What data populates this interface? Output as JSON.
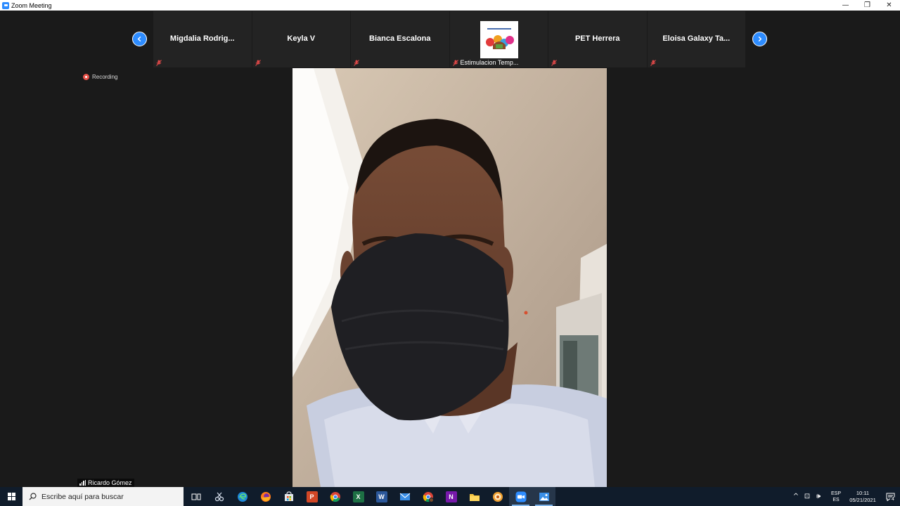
{
  "window": {
    "title": "Zoom Meeting",
    "controls": {
      "minimize": "—",
      "restore": "❐",
      "close": "✕"
    }
  },
  "gallery": {
    "participants": [
      {
        "name": "Migdalia  Rodrig...",
        "muted": true
      },
      {
        "name": "Keyla V",
        "muted": true
      },
      {
        "name": "Bianca Escalona",
        "muted": true
      },
      {
        "name": "Estimulacion Temp...",
        "muted": true,
        "has_thumbnail": true
      },
      {
        "name": "PET Herrera",
        "muted": true
      },
      {
        "name": "Eloisa Galaxy  Ta...",
        "muted": true
      }
    ]
  },
  "recording": {
    "label": "Recording"
  },
  "active_speaker": {
    "name": "Ricardo Gómez"
  },
  "taskbar": {
    "search_placeholder": "Escribe aquí para buscar",
    "apps": [
      {
        "icon": "task-view-icon",
        "active": false
      },
      {
        "icon": "snipping-tool-icon",
        "active": false
      },
      {
        "icon": "edge-icon",
        "active": false
      },
      {
        "icon": "firefox-icon",
        "active": false
      },
      {
        "icon": "store-icon",
        "active": false
      },
      {
        "icon": "powerpoint-icon",
        "active": false
      },
      {
        "icon": "chrome-icon",
        "active": false
      },
      {
        "icon": "excel-icon",
        "active": false
      },
      {
        "icon": "word-icon",
        "active": false
      },
      {
        "icon": "mail-icon",
        "active": false
      },
      {
        "icon": "chrome-profile-icon",
        "active": false
      },
      {
        "icon": "onenote-icon",
        "active": false
      },
      {
        "icon": "file-explorer-icon",
        "active": false
      },
      {
        "icon": "app-orange-icon",
        "active": false
      },
      {
        "icon": "zoom-icon",
        "active": true
      },
      {
        "icon": "photos-icon",
        "active": true
      }
    ],
    "tray": {
      "lang_top": "ESP",
      "lang_bottom": "ES",
      "time": "10:11",
      "date": "05/21/2021",
      "notifications": "4"
    }
  },
  "colors": {
    "accent": "#2d8cff",
    "recording": "#e8534a",
    "taskbar": "#101c2b",
    "background": "#1a1a1a"
  }
}
